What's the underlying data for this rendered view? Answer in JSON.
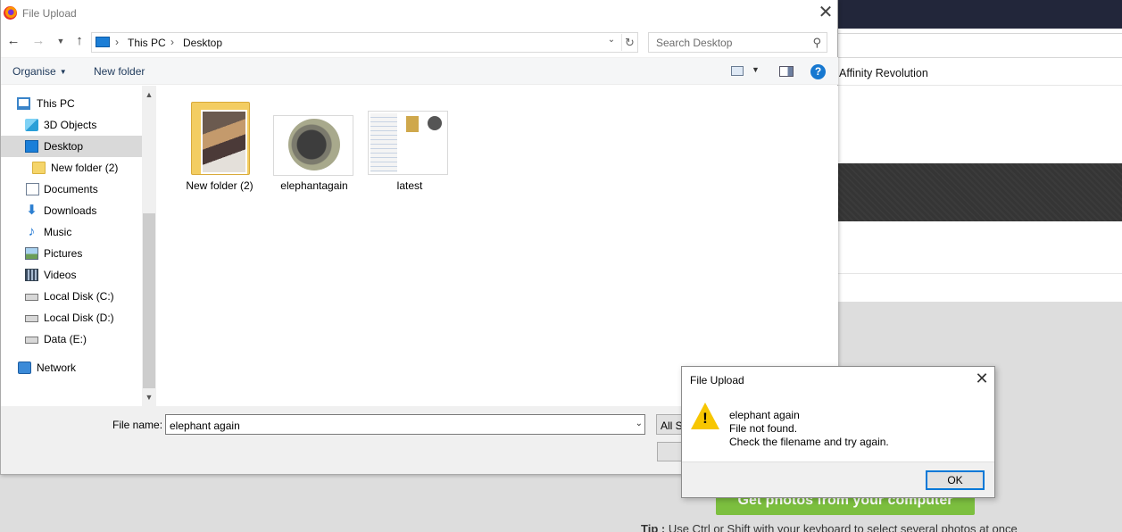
{
  "background_page": {
    "bookmark": "Affinity Revolution",
    "primary_button": "Get photos from your computer",
    "tip_label": "Tip :",
    "tip_text": "Use Ctrl or Shift with your keyboard to select several photos at once"
  },
  "dialog": {
    "title": "File Upload",
    "close_glyph": "✕",
    "breadcrumb": [
      "This PC",
      "Desktop"
    ],
    "search_placeholder": "Search Desktop",
    "toolbar": {
      "organise": "Organise",
      "new_folder": "New folder",
      "help": "?"
    },
    "nav_items": [
      {
        "label": "This PC",
        "icon": "computer-icon"
      },
      {
        "label": "3D Objects",
        "icon": "3d-objects-icon"
      },
      {
        "label": "Desktop",
        "icon": "desktop-icon",
        "selected": true
      },
      {
        "label": "New folder (2)",
        "icon": "folder-icon"
      },
      {
        "label": "Documents",
        "icon": "documents-icon"
      },
      {
        "label": "Downloads",
        "icon": "downloads-icon"
      },
      {
        "label": "Music",
        "icon": "music-icon"
      },
      {
        "label": "Pictures",
        "icon": "pictures-icon"
      },
      {
        "label": "Videos",
        "icon": "videos-icon"
      },
      {
        "label": "Local Disk (C:)",
        "icon": "drive-icon"
      },
      {
        "label": "Local Disk (D:)",
        "icon": "drive-icon"
      },
      {
        "label": "Data (E:)",
        "icon": "drive-icon"
      },
      {
        "label": "Network",
        "icon": "network-icon"
      }
    ],
    "files": [
      {
        "name": "New folder (2)",
        "type": "folder"
      },
      {
        "name": "elephantagain",
        "type": "image"
      },
      {
        "name": "latest",
        "type": "image"
      }
    ],
    "file_name_label": "File name:",
    "file_name_value": "elephant again",
    "file_type_filter": "All Supported Types"
  },
  "message_box": {
    "title": "File Upload",
    "close_glyph": "✕",
    "icon": "warning-icon",
    "lines": [
      "elephant again",
      "File not found.",
      "Check the filename and try again."
    ],
    "ok_label": "OK"
  }
}
